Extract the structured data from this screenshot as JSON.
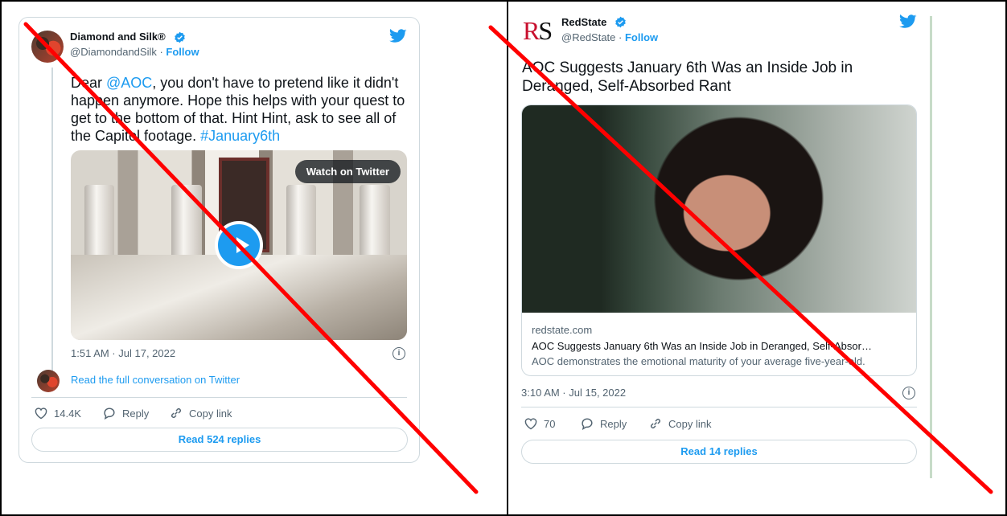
{
  "left_tweet": {
    "author_name": "Diamond and Silk®",
    "author_handle": "@DiamondandSilk",
    "handle_separator": " · ",
    "follow_label": "Follow",
    "text_parts": {
      "t1": "Dear ",
      "mention": "@AOC",
      "t2": ", you don't have to pretend like it didn't happen anymore.  Hope this helps with your quest to get to the bottom of that.  Hint Hint, ask to see all of the Capitol footage. ",
      "hashtag": "#January6th"
    },
    "watch_label": "Watch on Twitter",
    "timestamp": "1:51 AM · Jul 17, 2022",
    "read_conversation": "Read the full conversation on Twitter",
    "likes": "14.4K",
    "reply_label": "Reply",
    "copy_link_label": "Copy link",
    "read_replies": "Read 524 replies"
  },
  "right_tweet": {
    "author_name": "RedState",
    "author_handle": "@RedState",
    "handle_separator": " · ",
    "follow_label": "Follow",
    "logo_r": "R",
    "logo_s": "S",
    "headline": "AOC Suggests January 6th Was an Inside Job in Deranged, Self-Absorbed Rant",
    "card": {
      "domain": "redstate.com",
      "title": "AOC Suggests January 6th Was an Inside Job in Deranged, Self-Absor…",
      "description": "AOC demonstrates the emotional maturity of your average five-year-old."
    },
    "timestamp": "3:10 AM · Jul 15, 2022",
    "likes": "70",
    "reply_label": "Reply",
    "copy_link_label": "Copy link",
    "read_replies": "Read 14 replies"
  },
  "colors": {
    "twitter_blue": "#1d9bf0",
    "cross_red": "#ff0000",
    "text_dark": "#0f1419",
    "text_muted": "#536471"
  },
  "icons": [
    "twitter-bird-icon",
    "verified-badge-icon",
    "heart-icon",
    "reply-bubble-icon",
    "link-icon",
    "info-icon",
    "play-icon"
  ]
}
